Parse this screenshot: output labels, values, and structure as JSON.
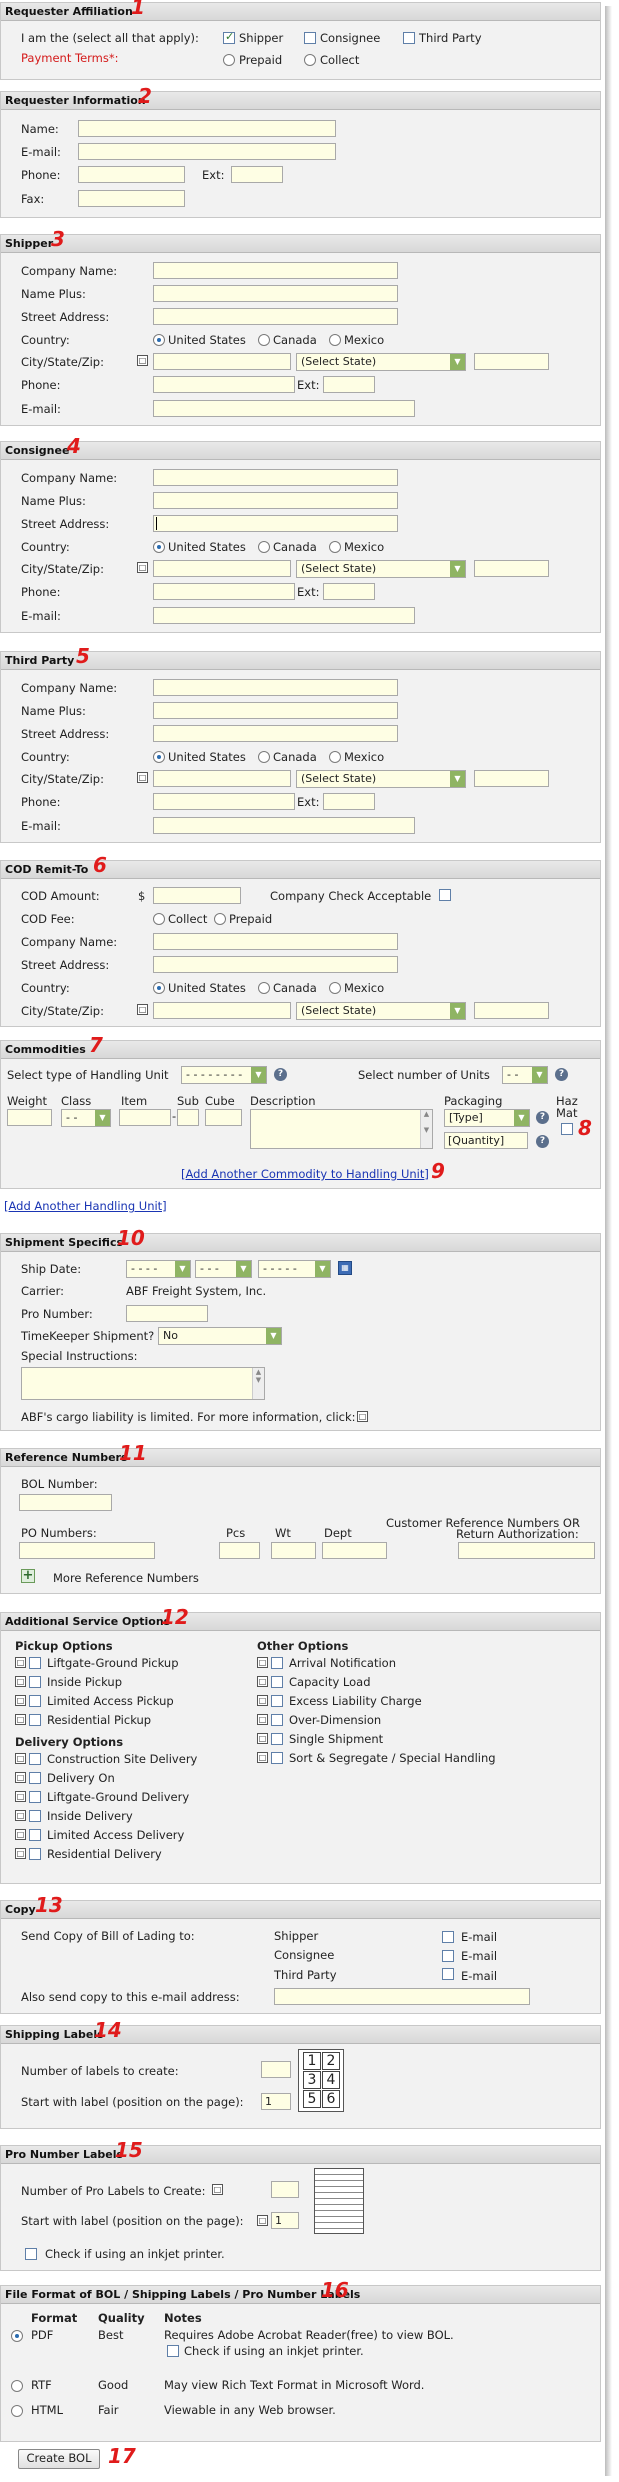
{
  "sections": {
    "requester_affiliation": {
      "title": "Requester Affiliation",
      "marker": "1",
      "i_am_label": "I am the (select all that apply):",
      "shipper": "Shipper",
      "consignee": "Consignee",
      "third_party": "Third Party",
      "payment_terms": "Payment Terms*:",
      "prepaid": "Prepaid",
      "collect": "Collect"
    },
    "requester_info": {
      "title": "Requester Information",
      "marker": "2",
      "name": "Name:",
      "email": "E-mail:",
      "phone": "Phone:",
      "ext": "Ext:",
      "fax": "Fax:"
    },
    "shipper": {
      "title": "Shipper",
      "marker": "3",
      "company": "Company Name:",
      "name_plus": "Name Plus:",
      "street": "Street Address:",
      "country": "Country:",
      "us": "United States",
      "canada": "Canada",
      "mexico": "Mexico",
      "city": "City/State/Zip:",
      "select_state": "(Select State)",
      "phone": "Phone:",
      "ext": "Ext:",
      "email": "E-mail:"
    },
    "consignee": {
      "title": "Consignee",
      "marker": "4",
      "company": "Company Name:",
      "name_plus": "Name Plus:",
      "street": "Street Address:",
      "country": "Country:",
      "us": "United States",
      "canada": "Canada",
      "mexico": "Mexico",
      "city": "City/State/Zip:",
      "select_state": "(Select State)",
      "phone": "Phone:",
      "ext": "Ext:",
      "email": "E-mail:"
    },
    "third_party": {
      "title": "Third Party",
      "marker": "5",
      "company": "Company Name:",
      "name_plus": "Name Plus:",
      "street": "Street Address:",
      "country": "Country:",
      "us": "United States",
      "canada": "Canada",
      "mexico": "Mexico",
      "city": "City/State/Zip:",
      "select_state": "(Select State)",
      "phone": "Phone:",
      "ext": "Ext:",
      "email": "E-mail:"
    },
    "cod": {
      "title": "COD Remit-To",
      "marker": "6",
      "amount": "COD Amount:",
      "dollar": "$",
      "check_ok": "Company Check Acceptable",
      "fee": "COD Fee:",
      "collect": "Collect",
      "prepaid": "Prepaid",
      "company": "Company Name:",
      "street": "Street Address:",
      "country": "Country:",
      "us": "United States",
      "canada": "Canada",
      "mexico": "Mexico",
      "city": "City/State/Zip:",
      "select_state": "(Select State)"
    },
    "commodities": {
      "title": "Commodities",
      "marker": "7",
      "marker8": "8",
      "marker9": "9",
      "handling_label": "Select type of Handling Unit",
      "handling_value": "- - - - - - - -",
      "units_label": "Select number of Units",
      "units_value": "- -",
      "weight": "Weight",
      "class": "Class",
      "item": "Item",
      "sub": "Sub",
      "cube": "Cube",
      "description": "Description",
      "packaging": "Packaging",
      "haz": "Haz",
      "mat": "Mat",
      "class_value": "- -",
      "type_value": "[Type]",
      "quantity_value": "[Quantity]",
      "add_commodity": "[Add Another Commodity to Handling Unit]",
      "add_handling": "[Add Another Handling Unit]"
    },
    "shipment": {
      "title": "Shipment Specifics",
      "marker": "10",
      "ship_date": "Ship Date:",
      "month": "- - - -",
      "day": "- - -",
      "year": "- - - - -",
      "carrier_label": "Carrier:",
      "carrier_value": "ABF Freight System, Inc.",
      "pro": "Pro Number:",
      "timekeeper": "TimeKeeper Shipment?",
      "timekeeper_value": "No",
      "special": "Special Instructions:",
      "liability": "ABF's cargo liability is limited. For more information, click:"
    },
    "reference": {
      "title": "Reference Numbers",
      "marker": "11",
      "bol": "BOL Number:",
      "po": "PO Numbers:",
      "pcs": "Pcs",
      "wt": "Wt",
      "dept": "Dept",
      "cust_ref1": "Customer Reference Numbers OR",
      "cust_ref2": "Return Authorization:",
      "more": "More Reference Numbers"
    },
    "additional": {
      "title": "Additional Service Options",
      "marker": "12",
      "pickup_head": "Pickup Options",
      "pickup": [
        "Liftgate-Ground Pickup",
        "Inside Pickup",
        "Limited Access Pickup",
        "Residential Pickup"
      ],
      "delivery_head": "Delivery Options",
      "delivery": [
        "Construction Site Delivery",
        "Delivery On",
        "Liftgate-Ground Delivery",
        "Inside Delivery",
        "Limited Access Delivery",
        "Residential Delivery"
      ],
      "other_head": "Other Options",
      "other": [
        "Arrival Notification",
        "Capacity Load",
        "Excess Liability Charge",
        "Over-Dimension",
        "Single Shipment",
        "Sort & Segregate / Special Handling"
      ]
    },
    "copy": {
      "title": "Copy",
      "marker": "13",
      "send_label": "Send Copy of Bill of Lading to:",
      "shipper": "Shipper",
      "consignee": "Consignee",
      "third_party": "Third Party",
      "email": "E-mail",
      "also": "Also send copy to this e-mail address:"
    },
    "labels": {
      "title": "Shipping Labels",
      "marker": "14",
      "number": "Number of labels to create:",
      "start": "Start with label (position on the page):",
      "start_value": "1",
      "grid": [
        "1",
        "2",
        "3",
        "4",
        "5",
        "6"
      ]
    },
    "pro_labels": {
      "title": "Pro Number Labels",
      "marker": "15",
      "number": "Number of Pro Labels to Create:",
      "start": "Start with label (position on the page):",
      "start_value": "1",
      "inkjet": "Check if using an inkjet printer."
    },
    "file_format": {
      "title": "File Format of BOL / Shipping Labels / Pro Number Labels",
      "marker": "16",
      "format": "Format",
      "quality": "Quality",
      "notes": "Notes",
      "pdf": "PDF",
      "pdf_q": "Best",
      "pdf_n": "Requires Adobe Acrobat Reader(free) to view BOL.",
      "pdf_ink": "Check if using an inkjet printer.",
      "rtf": "RTF",
      "rtf_q": "Good",
      "rtf_n": "May view Rich Text Format in Microsoft Word.",
      "html": "HTML",
      "html_q": "Fair",
      "html_n": "Viewable in any Web browser."
    }
  },
  "create_button": "Create BOL",
  "marker17": "17",
  "colors": {
    "accent": "#e01b1b",
    "field": "#fefee4",
    "header": "#dcdcdc",
    "link": "#1a35b3"
  }
}
